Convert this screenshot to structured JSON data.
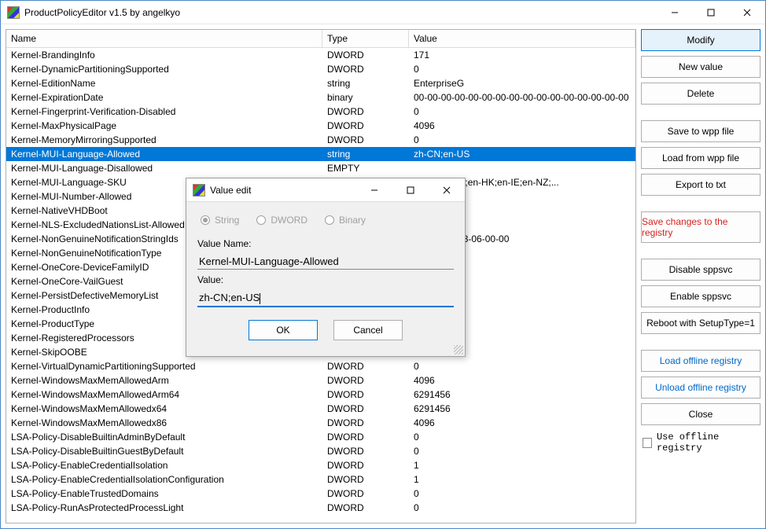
{
  "window": {
    "title": "ProductPolicyEditor v1.5 by angelkyo"
  },
  "columns": {
    "name": "Name",
    "type": "Type",
    "value": "Value"
  },
  "rows": [
    {
      "name": "Kernel-BrandingInfo",
      "type": "DWORD",
      "value": "171",
      "sel": false
    },
    {
      "name": "Kernel-DynamicPartitioningSupported",
      "type": "DWORD",
      "value": "0",
      "sel": false
    },
    {
      "name": "Kernel-EditionName",
      "type": "string",
      "value": "EnterpriseG",
      "sel": false
    },
    {
      "name": "Kernel-ExpirationDate",
      "type": "binary",
      "value": "00-00-00-00-00-00-00-00-00-00-00-00-00-00-00-00",
      "sel": false
    },
    {
      "name": "Kernel-Fingerprint-Verification-Disabled",
      "type": "DWORD",
      "value": "0",
      "sel": false
    },
    {
      "name": "Kernel-MaxPhysicalPage",
      "type": "DWORD",
      "value": "4096",
      "sel": false
    },
    {
      "name": "Kernel-MemoryMirroringSupported",
      "type": "DWORD",
      "value": "0",
      "sel": false
    },
    {
      "name": "Kernel-MUI-Language-Allowed",
      "type": "string",
      "value": "zh-CN;en-US",
      "sel": true
    },
    {
      "name": "Kernel-MUI-Language-Disallowed",
      "type": "EMPTY",
      "value": "",
      "sel": false
    },
    {
      "name": "Kernel-MUI-Language-SKU",
      "type": "",
      "value": "n-CA;en-GB;en-HK;en-IE;en-NZ;...",
      "sel": false
    },
    {
      "name": "Kernel-MUI-Number-Allowed",
      "type": "",
      "value": "",
      "sel": false
    },
    {
      "name": "Kernel-NativeVHDBoot",
      "type": "",
      "value": "",
      "sel": false
    },
    {
      "name": "Kernel-NLS-ExcludedNationsList-Allowed",
      "type": "",
      "value": "",
      "sel": false
    },
    {
      "name": "Kernel-NonGenuineNotificationStringIds",
      "type": "",
      "value": "-02-00-00-53-06-00-00",
      "sel": false
    },
    {
      "name": "Kernel-NonGenuineNotificationType",
      "type": "",
      "value": "",
      "sel": false
    },
    {
      "name": "Kernel-OneCore-DeviceFamilyID",
      "type": "",
      "value": "",
      "sel": false
    },
    {
      "name": "Kernel-OneCore-VailGuest",
      "type": "",
      "value": "",
      "sel": false
    },
    {
      "name": "Kernel-PersistDefectiveMemoryList",
      "type": "",
      "value": "",
      "sel": false
    },
    {
      "name": "Kernel-ProductInfo",
      "type": "",
      "value": "",
      "sel": false
    },
    {
      "name": "Kernel-ProductType",
      "type": "",
      "value": "",
      "sel": false
    },
    {
      "name": "Kernel-RegisteredProcessors",
      "type": "",
      "value": "",
      "sel": false
    },
    {
      "name": "Kernel-SkipOOBE",
      "type": "DWORD",
      "value": "0",
      "sel": false
    },
    {
      "name": "Kernel-VirtualDynamicPartitioningSupported",
      "type": "DWORD",
      "value": "0",
      "sel": false
    },
    {
      "name": "Kernel-WindowsMaxMemAllowedArm",
      "type": "DWORD",
      "value": "4096",
      "sel": false
    },
    {
      "name": "Kernel-WindowsMaxMemAllowedArm64",
      "type": "DWORD",
      "value": "6291456",
      "sel": false
    },
    {
      "name": "Kernel-WindowsMaxMemAllowedx64",
      "type": "DWORD",
      "value": "6291456",
      "sel": false
    },
    {
      "name": "Kernel-WindowsMaxMemAllowedx86",
      "type": "DWORD",
      "value": "4096",
      "sel": false
    },
    {
      "name": "LSA-Policy-DisableBuiltinAdminByDefault",
      "type": "DWORD",
      "value": "0",
      "sel": false
    },
    {
      "name": "LSA-Policy-DisableBuiltinGuestByDefault",
      "type": "DWORD",
      "value": "0",
      "sel": false
    },
    {
      "name": "LSA-Policy-EnableCredentialIsolation",
      "type": "DWORD",
      "value": "1",
      "sel": false
    },
    {
      "name": "LSA-Policy-EnableCredentialIsolationConfiguration",
      "type": "DWORD",
      "value": "1",
      "sel": false
    },
    {
      "name": "LSA-Policy-EnableTrustedDomains",
      "type": "DWORD",
      "value": "0",
      "sel": false
    },
    {
      "name": "LSA-Policy-RunAsProtectedProcessLight",
      "type": "DWORD",
      "value": "0",
      "sel": false
    }
  ],
  "side": {
    "modify": "Modify",
    "new_value": "New value",
    "delete": "Delete",
    "save_wpp": "Save to wpp file",
    "load_wpp": "Load from wpp file",
    "export_txt": "Export to txt",
    "save_registry": "Save changes to the registry",
    "disable_sppsvc": "Disable sppsvc",
    "enable_sppsvc": "Enable sppsvc",
    "reboot": "Reboot with SetupType=1",
    "load_offline": "Load offline registry",
    "unload_offline": "Unload offline registry",
    "close": "Close",
    "use_offline": "Use offline registry"
  },
  "dialog": {
    "title": "Value edit",
    "radio_string": "String",
    "radio_dword": "DWORD",
    "radio_binary": "Binary",
    "label_name": "Value Name:",
    "name_value": "Kernel-MUI-Language-Allowed",
    "label_value": "Value:",
    "value_value": "zh-CN;en-US",
    "ok": "OK",
    "cancel": "Cancel"
  }
}
